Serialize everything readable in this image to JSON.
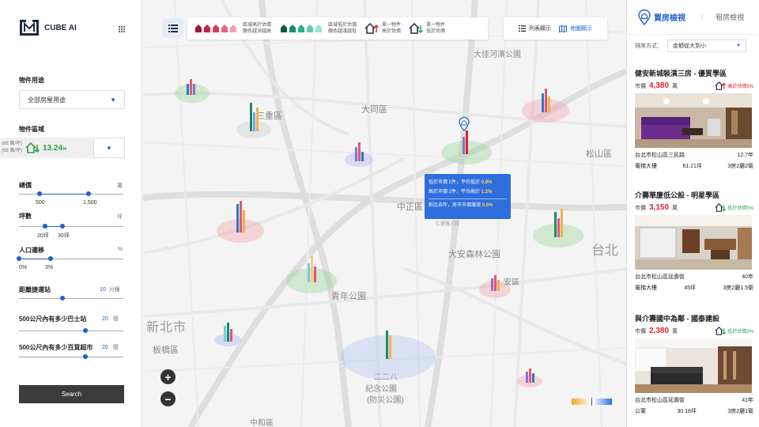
{
  "app": {
    "name": "CUBE AI"
  },
  "filters": {
    "usage_label": "物件用途",
    "usage_value": "全部房屋用途",
    "region_label": "物件區域",
    "region_sub1": "(68 萬/坪)",
    "region_sub2": "(68 萬/坪)",
    "region_pct": "13.24",
    "region_pct_unit": "%",
    "total_label": "總價",
    "total_unit": "萬",
    "total_min": "500",
    "total_max": "1,500",
    "total_range": [
      0.2,
      0.67
    ],
    "area_label": "坪數",
    "area_unit": "坪",
    "area_min": "20坪",
    "area_max": "30坪",
    "area_range": [
      0.25,
      0.42
    ],
    "pop_label": "人口遷移",
    "pop_unit": "%",
    "pop_min": "0%",
    "pop_max": "3%",
    "pop_range": [
      0.0,
      0.3
    ],
    "mrt_label": "距離捷運站",
    "mrt_value": "10",
    "mrt_unit": "分鐘",
    "mrt_level": 0.42,
    "bus_label": "500公尺內有多少巴士站",
    "bus_value": "20",
    "bus_unit": "個",
    "bus_level": 0.64,
    "store_label": "500公尺內有多少百貨超市",
    "store_value": "20",
    "store_unit": "個",
    "store_level": 0.64,
    "search_label": "Search"
  },
  "legend": {
    "high_text1": "區域高於估價",
    "high_text2": "顏色越深越高",
    "low_text1": "區域低於估價",
    "low_text2": "顏色越淺越低",
    "item_high1": "單一物件",
    "item_high2": "高於估價",
    "item_low1": "單一物件",
    "item_low2": "低於估價",
    "red_color": "#d93a5a",
    "green_color": "#1c8a6e"
  },
  "view": {
    "list_label": "列表顯示",
    "map_label": "地圖顯示"
  },
  "map": {
    "labels": [
      {
        "text": "大佳河濱公園",
        "cls": "m"
      },
      {
        "text": "三重區",
        "cls": "d"
      },
      {
        "text": "大同區",
        "cls": "d"
      },
      {
        "text": "松山區",
        "cls": "d"
      },
      {
        "text": "中正區",
        "cls": "d"
      },
      {
        "text": "大安森林公園",
        "cls": "m"
      },
      {
        "text": "台北",
        "cls": "c"
      },
      {
        "text": "新北市",
        "cls": "c"
      },
      {
        "text": "青年公園",
        "cls": "m"
      },
      {
        "text": "板橋區",
        "cls": "d"
      },
      {
        "text": "安區",
        "cls": "d"
      },
      {
        "text": "二二八",
        "cls": "m"
      },
      {
        "text": "紀念公園",
        "cls": "m"
      },
      {
        "text": "(防災公園)",
        "cls": "m"
      },
      {
        "text": "中和區",
        "cls": "d"
      },
      {
        "text": "仁愛路三段",
        "cls": "s"
      }
    ],
    "tooltip": {
      "line1_a": "低於市價 5件，平均低於",
      "line1_b": "0.8%",
      "line2_a": "高於市價 2件，平均高於",
      "line2_b": "1.2%",
      "line3_a": "對比去年，房市市價增漲",
      "line3_b": "0.5%"
    }
  },
  "panel": {
    "tab_buy": "買房檢視",
    "tab_rent": "租房檢視",
    "sort_label": "排序方式：",
    "sort_value": "金額從大到小",
    "price_label": "市價",
    "price_unit": "萬",
    "listings": [
      {
        "title": "健安新城裝潢三房 - 優質學區",
        "price": "4,380",
        "badge": "高於估價5%",
        "badge_color": "#e2202f",
        "address": "台北市松山區三民路",
        "age": "12.7年",
        "type": "電梯大樓",
        "area": "61.21坪",
        "layout": "3房2廳2衛"
      },
      {
        "title": "介壽華廈低公設 - 明星學區",
        "price": "3,150",
        "badge": "低於估價5%",
        "badge_color": "#2aa34a",
        "address": "台北市松山區延壽街",
        "age": "40年",
        "type": "電梯大樓",
        "area": "45坪",
        "layout": "3房2廳1.5衛"
      },
      {
        "title": "與介壽國中為鄰 - 國泰建設",
        "price": "2,380",
        "badge": "低於估價2%",
        "badge_color": "#2aa34a",
        "address": "台北市松山區延壽街",
        "age": "41年",
        "type": "公寓",
        "area": "30.18坪",
        "layout": "3房2廳1衛"
      }
    ]
  }
}
